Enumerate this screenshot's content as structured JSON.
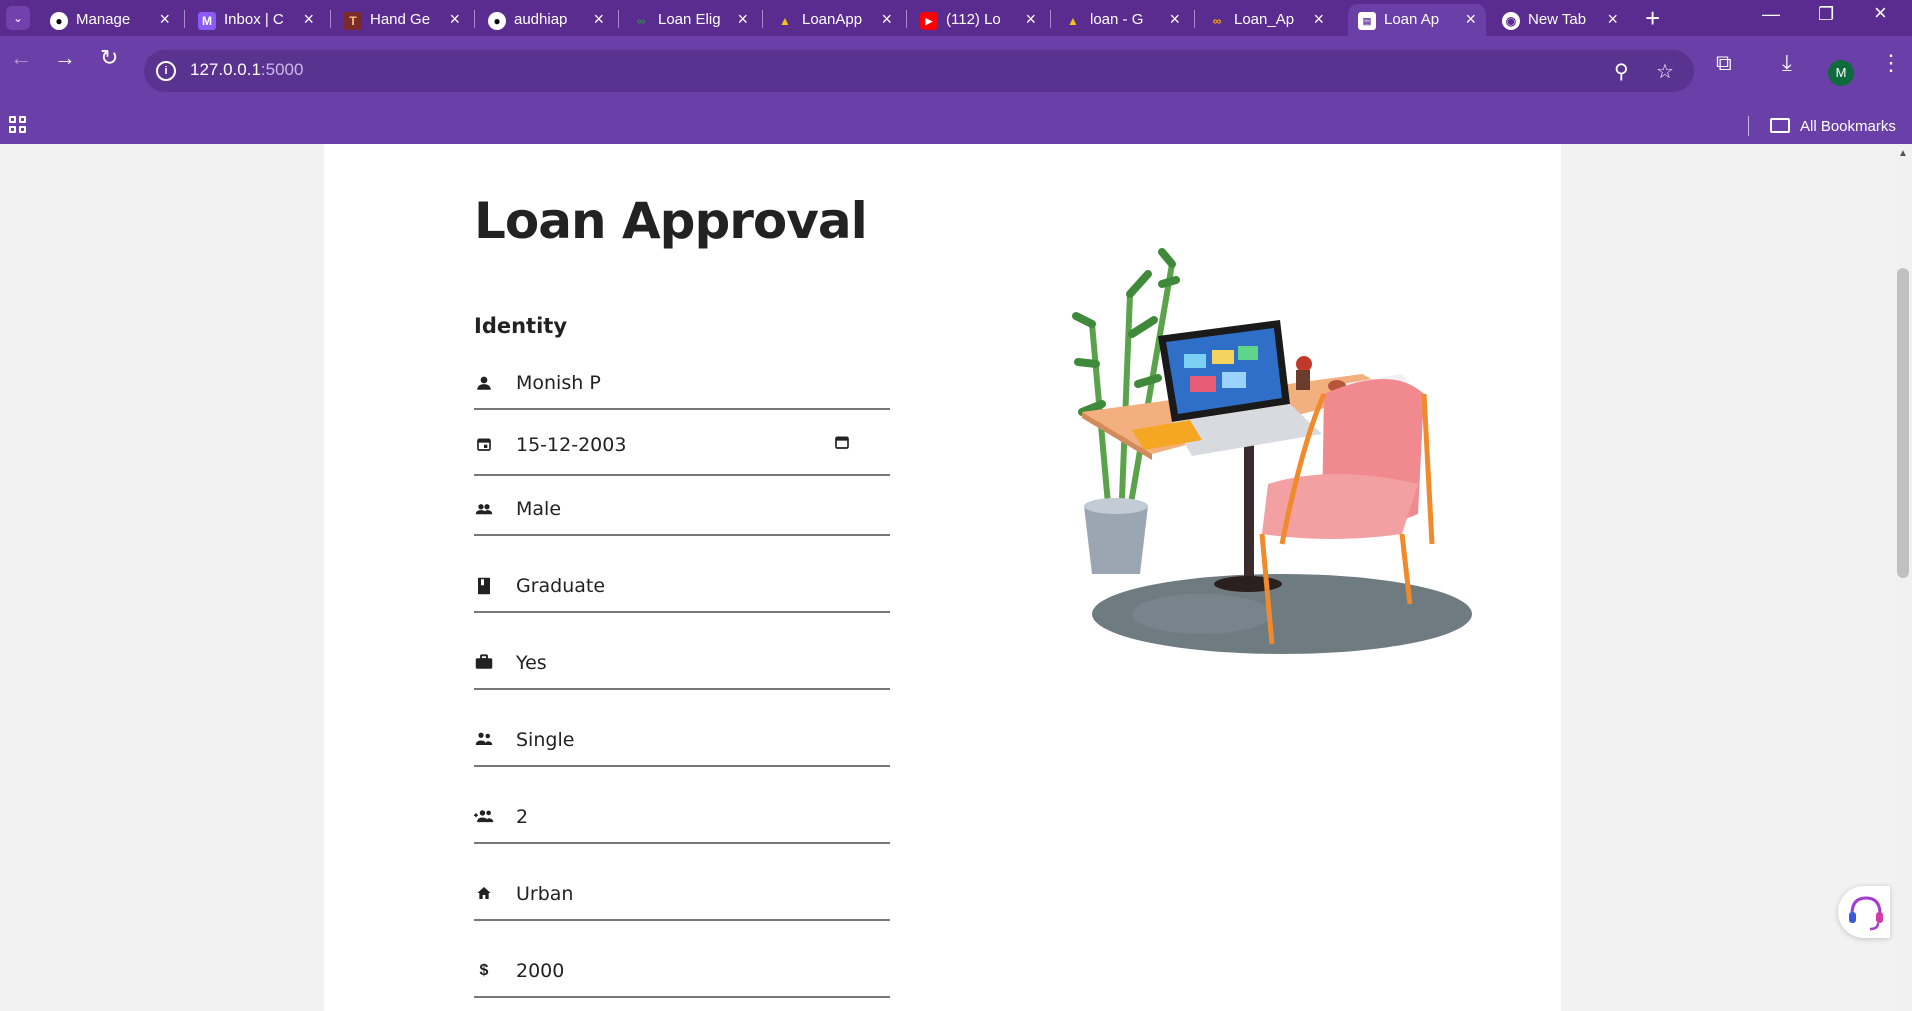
{
  "browser": {
    "tabs": [
      {
        "title": "Manage",
        "icon": "github-icon"
      },
      {
        "title": "Inbox | C",
        "icon": "mail-icon"
      },
      {
        "title": "Hand Ge",
        "icon": "site-icon"
      },
      {
        "title": "audhiap",
        "icon": "github-icon"
      },
      {
        "title": "Loan Elig",
        "icon": "gfg-icon"
      },
      {
        "title": "LoanApp",
        "icon": "drive-icon"
      },
      {
        "title": "(112) Lo",
        "icon": "youtube-icon"
      },
      {
        "title": "loan - G",
        "icon": "drive-icon"
      },
      {
        "title": "Loan_Ap",
        "icon": "colab-icon"
      },
      {
        "title": "Loan Ap",
        "icon": "page-icon",
        "active": true
      },
      {
        "title": "New Tab",
        "icon": "chrome-icon"
      }
    ],
    "address": {
      "host": "127.0.0.1",
      "port": ":5000"
    },
    "bookmarks_label": "All Bookmarks",
    "profile_initial": "M"
  },
  "page": {
    "title": "Loan Approval",
    "section": "Identity",
    "fields": [
      {
        "icon": "person-icon",
        "value": "Monish P"
      },
      {
        "icon": "calendar-icon",
        "value": "15-12-2003"
      },
      {
        "icon": "people-icon",
        "value": "Male"
      },
      {
        "icon": "book-icon",
        "value": "Graduate"
      },
      {
        "icon": "briefcase-icon",
        "value": "Yes"
      },
      {
        "icon": "couple-icon",
        "value": "Single"
      },
      {
        "icon": "group-add-icon",
        "value": "2"
      },
      {
        "icon": "home-icon",
        "value": "Urban"
      },
      {
        "icon": "dollar-icon",
        "value": "2000"
      }
    ]
  },
  "colors": {
    "tabstrip": "#5b2c8f",
    "toolbar": "#6a3fa7",
    "page_bg": "#f2f2f2"
  }
}
